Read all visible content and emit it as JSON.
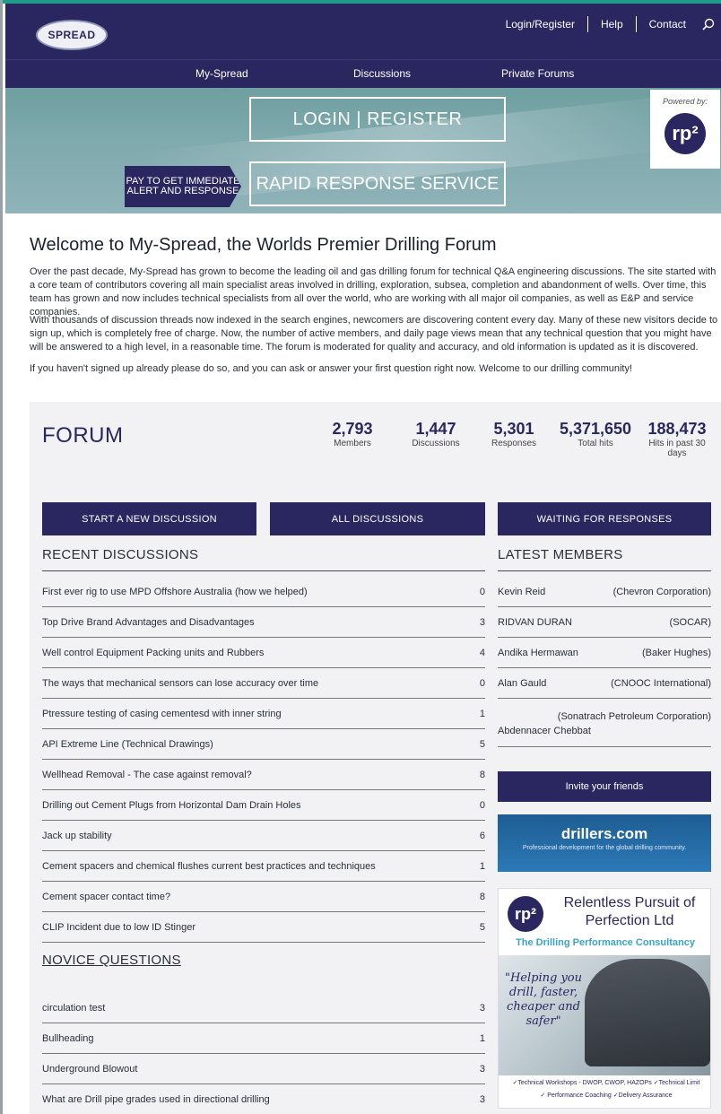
{
  "header": {
    "logo_text": "SPREAD",
    "links": {
      "login": "Login/Register",
      "help": "Help",
      "contact": "Contact"
    },
    "search_icon": "search-icon"
  },
  "nav": {
    "items": [
      "My-Spread",
      "Discussions",
      "Private Forums"
    ]
  },
  "hero": {
    "login_label": "LOGIN | REGISTER",
    "rapid_label": "RAPID RESPONSE SERVICE",
    "pay_label": "PAY TO GET IMMEDIATE ALERT AND RESPONSE",
    "powered_by": "Powered by:",
    "powered_logo": "rp²"
  },
  "welcome": {
    "title": "Welcome to My-Spread, the Worlds Premier Drilling Forum",
    "p1": "Over the past decade, My-Spread has grown to become the leading oil and gas drilling forum for technical Q&A engineering discussions. The site started with a core team of contributors covering all main specialist areas involved in drilling, exploration, subsea, completion and abandonment of wells. Over time, this team has grown and now includes technical specialists from all over the world, who are working with all major oil companies, as well as E&P and service companies.",
    "p2": "With thousands of discussion threads now indexed in the search engines, newcomers are discovering content every day. Many of these new visitors decide to sign up, which is completely free of charge. Now, the number of active members, and daily page views mean that any technical question that you might have will be answered to a high level, in a reasonable time. The forum is moderated for quality and accuracy, and old information is updated as it is discovered.",
    "p3": "If you haven't signed up already please do so, and you can ask or answer your first question right now. Welcome to our drilling community!"
  },
  "forum": {
    "title": "FORUM",
    "stats": [
      {
        "value": "2,793",
        "label": "Members"
      },
      {
        "value": "1,447",
        "label": "Discussions"
      },
      {
        "value": "5,301",
        "label": "Responses"
      },
      {
        "value": "5,371,650",
        "label": "Total hits"
      },
      {
        "value": "188,473",
        "label": "Hits in past 30 days"
      }
    ],
    "buttons": {
      "start": "START A NEW DISCUSSION",
      "all": "ALL DISCUSSIONS",
      "waiting": "WAITING FOR RESPONSES"
    },
    "recent_title": "RECENT DISCUSSIONS",
    "recent": [
      {
        "title": "First ever rig to use MPD Offshore Australia (how we helped)",
        "count": "0"
      },
      {
        "title": "Top Drive Brand Advantages and Disadvantages",
        "count": "3"
      },
      {
        "title": "Well control Equipment Packing units and Rubbers",
        "count": "4"
      },
      {
        "title": "The ways that mechanical sensors can lose accuracy over time",
        "count": "0"
      },
      {
        "title": "Ptressure testing of casing cementesd with inner string",
        "count": "1"
      },
      {
        "title": "API Extreme Line (Technical Drawings)",
        "count": "5"
      },
      {
        "title": "Wellhead Removal - The case against removal?",
        "count": "8"
      },
      {
        "title": "Drilling out Cement Plugs from Horizontal Dam Drain Holes",
        "count": "0"
      },
      {
        "title": "Jack up stability",
        "count": "6"
      },
      {
        "title": "Cement spacers and chemical flushes current best practices and techniques",
        "count": "1"
      },
      {
        "title": "Cement spacer contact time?",
        "count": "8"
      },
      {
        "title": "CLIP Incident due to low ID Stinger",
        "count": "5"
      }
    ],
    "novice_title": "NOVICE QUESTIONS",
    "novice": [
      {
        "title": "circulation test",
        "count": "3"
      },
      {
        "title": "Bullheading",
        "count": "1"
      },
      {
        "title": "Underground Blowout",
        "count": "3"
      },
      {
        "title": "What are Drill pipe grades used in directional drilling",
        "count": "3"
      }
    ],
    "members_title": "LATEST MEMBERS",
    "members": [
      {
        "name": "Kevin Reid",
        "company": "(Chevron Corporation)"
      },
      {
        "name": "RIDVAN DURAN",
        "company": "(SOCAR)"
      },
      {
        "name": "Andika Hermawan",
        "company": "(Baker Hughes)"
      },
      {
        "name": "Alan Gauld",
        "company": "(CNOOC International)"
      },
      {
        "name": "Abdennacer Chebbat",
        "company": "(Sonatrach Petroleum Corporation)"
      }
    ],
    "invite_label": "Invite your friends",
    "drillers": {
      "name": "drillers.com",
      "tagline": "Professional development for the global drilling community."
    },
    "rp_ad": {
      "logo": "rp²",
      "company": "Relentless Pursuit of Perfection Ltd",
      "tagline": "The Drilling Performance Consultancy",
      "quote": "\"Helping you drill, faster, cheaper and safer\"",
      "bullets1": "✓Technical Workshops - DWOP, CWOP, HAZOPs  ✓Technical Limit",
      "bullets2": "✓ Performance Coaching   ✓Delivery Assurance"
    }
  }
}
